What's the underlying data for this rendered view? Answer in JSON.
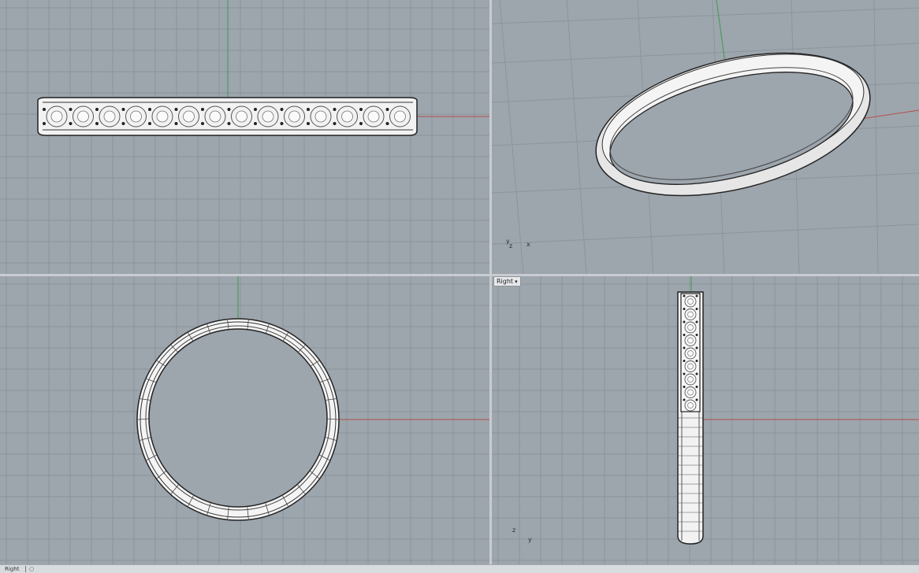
{
  "viewports": {
    "top": {
      "label": ""
    },
    "perspective": {
      "label": "",
      "axis_indicator": {
        "y": "y",
        "z": "z",
        "x": "x"
      }
    },
    "front": {
      "label": ""
    },
    "right": {
      "label": "Right",
      "axis_indicator": {
        "z": "z",
        "y": "y"
      }
    }
  },
  "tabs": [
    {
      "label": "Right"
    }
  ],
  "add_tab_symbol": "○",
  "colors": {
    "viewport_bg": "#9da5ad",
    "grid": "#8d959c",
    "grid_major": "#7c848b",
    "x_axis": "#b4504a",
    "y_axis": "#3f9a4a",
    "ring_fill": "#f4f4f4",
    "ring_edge": "#222222"
  }
}
